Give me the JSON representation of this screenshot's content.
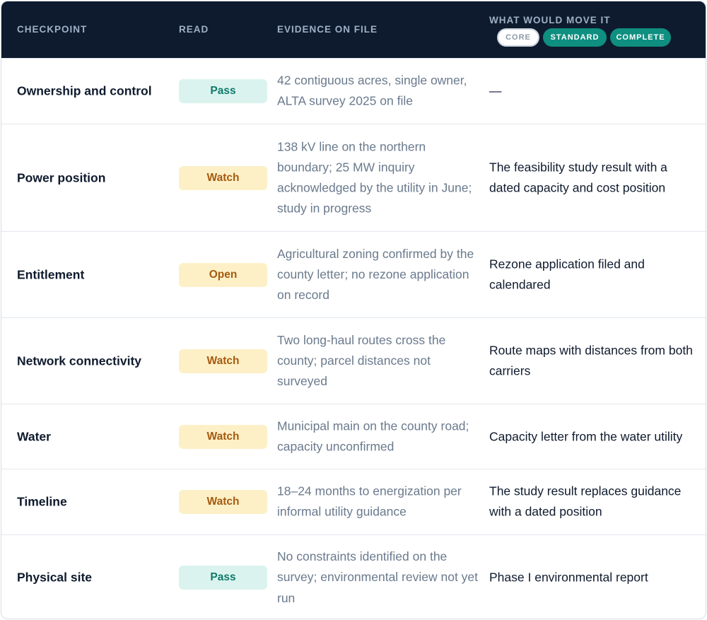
{
  "table": {
    "headers": {
      "checkpoint": "CHECKPOINT",
      "read": "READ",
      "evidence": "EVIDENCE ON FILE",
      "move": "WHAT WOULD MOVE IT"
    },
    "tiers": [
      {
        "label": "CORE",
        "state": "inactive"
      },
      {
        "label": "STANDARD",
        "state": "active"
      },
      {
        "label": "COMPLETE",
        "state": "active"
      }
    ],
    "rows": [
      {
        "checkpoint": "Ownership and control",
        "read": "Pass",
        "evidence": "42 contiguous acres, single owner, ALTA survey 2025 on file",
        "move": "—"
      },
      {
        "checkpoint": "Power position",
        "read": "Watch",
        "evidence": "138 kV line on the northern boundary; 25 MW inquiry acknowledged by the utility in June; study in progress",
        "move": "The feasibility study result with a dated capacity and cost position"
      },
      {
        "checkpoint": "Entitlement",
        "read": "Open",
        "evidence": "Agricultural zoning confirmed by the county letter; no rezone application on record",
        "move": "Rezone application filed and calendared"
      },
      {
        "checkpoint": "Network connectivity",
        "read": "Watch",
        "evidence": "Two long-haul routes cross the county; parcel distances not surveyed",
        "move": "Route maps with distances from both carriers"
      },
      {
        "checkpoint": "Water",
        "read": "Watch",
        "evidence": "Municipal main on the county road; capacity unconfirmed",
        "move": "Capacity letter from the water utility"
      },
      {
        "checkpoint": "Timeline",
        "read": "Watch",
        "evidence": "18–24 months to energization per informal utility guidance",
        "move": "The study result replaces guidance with a dated position"
      },
      {
        "checkpoint": "Physical site",
        "read": "Pass",
        "evidence": "No constraints identified on the survey; environmental review not yet run",
        "move": "Phase I environmental report"
      }
    ]
  },
  "colors": {
    "header_bg": "#0e1b2e",
    "pass_bg": "#dbf3ee",
    "pass_text": "#107a6b",
    "watch_bg": "#fdf0c7",
    "watch_text": "#a55a10",
    "tier_active": "#0e8f80"
  }
}
